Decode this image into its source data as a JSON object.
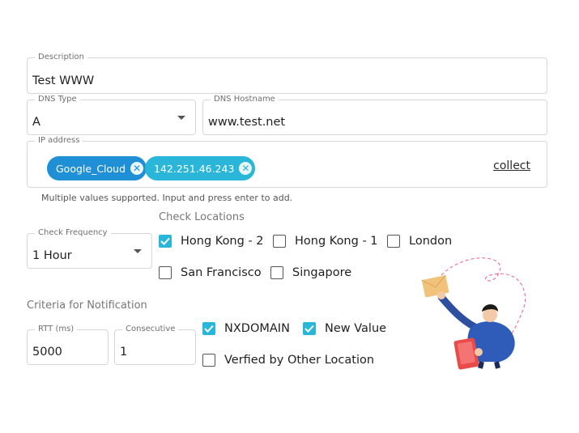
{
  "form": {
    "description": {
      "label": "Description",
      "value": "Test WWW"
    },
    "dns_type": {
      "label": "DNS Type",
      "value": "A"
    },
    "dns_hostname": {
      "label": "DNS Hostname",
      "value": "www.test.net"
    },
    "ip_address": {
      "label": "IP address",
      "chips": [
        {
          "label": "Google_Cloud",
          "color": "#1f8fd6"
        },
        {
          "label": "142.251.46.243",
          "color": "#29b6d8"
        }
      ],
      "collect_label": "collect",
      "helper": "Multiple values supported. Input and press enter to add."
    },
    "check_frequency": {
      "label": "Check Frequency",
      "value": "1 Hour"
    },
    "check_locations": {
      "title": "Check Locations",
      "items": [
        {
          "label": "Hong Kong - 2",
          "checked": true
        },
        {
          "label": "Hong Kong - 1",
          "checked": false
        },
        {
          "label": "London",
          "checked": false
        },
        {
          "label": "San Francisco",
          "checked": false
        },
        {
          "label": "Singapore",
          "checked": false
        }
      ]
    },
    "criteria": {
      "title": "Criteria for Notification",
      "rtt": {
        "label": "RTT (ms)",
        "value": "5000"
      },
      "consecutive": {
        "label": "Consecutive",
        "value": "1"
      },
      "options": [
        {
          "label": "NXDOMAIN",
          "checked": true
        },
        {
          "label": "New Value",
          "checked": true
        },
        {
          "label": "Verfied by Other Location",
          "checked": false
        }
      ]
    }
  },
  "colors": {
    "accent": "#29b6d8",
    "chip_primary": "#1f8fd6"
  },
  "illustration": {
    "name": "person-with-tablet-and-envelope-illustration"
  }
}
